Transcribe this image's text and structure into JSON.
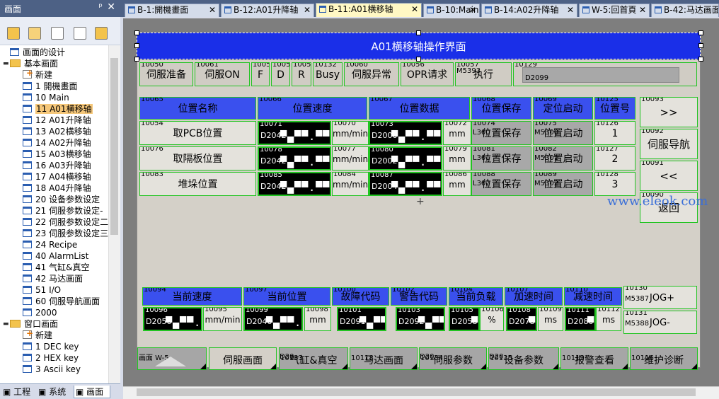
{
  "left_panel": {
    "title": "画面",
    "pin_glyph": "ᵖ",
    "close_glyph": "✕",
    "tree": {
      "design": "画面的设计",
      "basic_group": "基本画面",
      "basic_items": [
        "新建",
        "1 開機畫面",
        "10 Main",
        "11 A01横移轴",
        "12 A01升降轴",
        "13 A02横移轴",
        "14 A02升降轴",
        "15 A03横移轴",
        "16 A03升降轴",
        "17 A04横移轴",
        "18 A04升降轴",
        "20 设备参数设定",
        "21 伺服参数设定-",
        "22 伺服参数设定二",
        "23 伺服参数设定三",
        "24 Recipe",
        "40 AlarmList",
        "41 气缸&真空",
        "42 马达画面",
        "51 I/O",
        "60 伺服导航画面",
        "2000"
      ],
      "window_group": "窗口画面",
      "window_items": [
        "新建",
        "1 DEC key",
        "2 HEX key",
        "3 Ascii key"
      ]
    },
    "bottom_tabs": [
      "工程",
      "系统",
      "画面"
    ]
  },
  "doc_tabs": [
    {
      "label": "B-1:開機畫面"
    },
    {
      "label": "B-12:A01升降轴"
    },
    {
      "label": "B-11:A01横移轴"
    },
    {
      "label": "B-10:Main"
    },
    {
      "label": "B-14:A02升降轴"
    },
    {
      "label": "W-5:回首頁"
    },
    {
      "label": "B-42:马达画面"
    }
  ],
  "hmi": {
    "title": "A01横移轴操作界面",
    "status_row": [
      {
        "id": "10050",
        "label": "伺服准备"
      },
      {
        "id": "10061",
        "label": "伺服ON"
      },
      {
        "id": "10051",
        "label": "F"
      },
      {
        "id": "10052",
        "label": "D"
      },
      {
        "id": "10053",
        "label": "R"
      },
      {
        "id": "10132",
        "label": "Busy"
      },
      {
        "id": "10060",
        "label": "伺服异常"
      },
      {
        "id": "10056",
        "label": "OPR请求"
      },
      {
        "id": "10057",
        "label": "执行",
        "sub": "M5393"
      }
    ],
    "status_value": {
      "id": "10129",
      "reg": "D2099"
    },
    "table_headers": [
      {
        "id": "10065",
        "label": "位置名称"
      },
      {
        "id": "10066",
        "label": "位置速度"
      },
      {
        "id": "10067",
        "label": "位置数据"
      },
      {
        "id": "10068",
        "label": "位置保存"
      },
      {
        "id": "10069",
        "label": "定位启动"
      },
      {
        "id": "10125",
        "label": "位置号"
      }
    ],
    "rows": [
      {
        "name_id": "10054",
        "name": "取PCB位置",
        "spd_id": "10071",
        "spd_reg": "D2042",
        "spd_unit_id": "10070",
        "spd_unit": "mm/min",
        "pos_id": "10073",
        "pos_reg": "D2000",
        "pos_unit_id": "10072",
        "pos_unit": "mm",
        "save_id": "10074",
        "save_sub": "L300",
        "save": "位置保存",
        "start_id": "10075",
        "start_sub": "M5300",
        "start": "位置启动",
        "no_id": "10126",
        "no": "1"
      },
      {
        "name_id": "10076",
        "name": "取隔板位置",
        "spd_id": "10078",
        "spd_reg": "D2042",
        "spd_unit_id": "10077",
        "spd_unit": "mm/min",
        "pos_id": "10080",
        "pos_reg": "D2002",
        "pos_unit_id": "10079",
        "pos_unit": "mm",
        "save_id": "10081",
        "save_sub": "L301",
        "save": "位置保存",
        "start_id": "10082",
        "start_sub": "M5301",
        "start": "位置启动",
        "no_id": "10127",
        "no": "2"
      },
      {
        "name_id": "10083",
        "name": "堆垛位置",
        "spd_id": "10085",
        "spd_reg": "D2042",
        "spd_unit_id": "10084",
        "spd_unit": "mm/min",
        "pos_id": "10087",
        "pos_reg": "D2004",
        "pos_unit_id": "10086",
        "pos_unit": "mm",
        "save_id": "10088",
        "save_sub": "L302",
        "save": "位置保存",
        "start_id": "10089",
        "start_sub": "M5302",
        "start": "位置启动",
        "no_id": "10128",
        "no": "3"
      }
    ],
    "seg_mask": "▀▄▀▀.▀▀▀",
    "right_nav": [
      {
        "id": "10093",
        "label": ">>"
      },
      {
        "id": "10092",
        "label": "伺服导航"
      },
      {
        "id": "10091",
        "label": "<<"
      },
      {
        "id": "10090",
        "label": "返回"
      }
    ],
    "bottom_headers": [
      {
        "id": "10094",
        "label": "当前速度"
      },
      {
        "id": "10097",
        "label": "当前位置"
      },
      {
        "id": "10100",
        "label": "故障代码"
      },
      {
        "id": "10102",
        "label": "警告代码"
      },
      {
        "id": "10104",
        "label": "当前负载"
      },
      {
        "id": "10107",
        "label": "加速时间"
      },
      {
        "id": "10110",
        "label": "减速时间"
      }
    ],
    "bottom_values": [
      {
        "id": "10096",
        "reg": "D2056",
        "unit_id": "10095",
        "unit": "mm/min"
      },
      {
        "id": "10099",
        "reg": "D2040",
        "unit_id": "10098",
        "unit": "mm"
      },
      {
        "id": "10101",
        "reg": "D2091",
        "unit_id": "",
        "unit": ""
      },
      {
        "id": "10103",
        "reg": "D2092",
        "unit_id": "",
        "unit": ""
      },
      {
        "id": "10105",
        "reg": "D2058",
        "unit_id": "10106",
        "unit": "%"
      },
      {
        "id": "10108",
        "reg": "D2078",
        "unit_id": "10109",
        "unit": "ms"
      },
      {
        "id": "10111",
        "reg": "D2080",
        "unit_id": "10112",
        "unit": "ms"
      }
    ],
    "jog": [
      {
        "id": "10130",
        "sub": "M5387",
        "label": "JOG+"
      },
      {
        "id": "10131",
        "sub": "M5388",
        "label": "JOG-"
      }
    ],
    "bottom_nav": [
      {
        "id": "画面 W-5",
        "label": ""
      },
      {
        "id": "",
        "label": "伺服画面"
      },
      {
        "id": "10133",
        "sub": "D20",
        "label": "气缸&真空"
      },
      {
        "id": "10118",
        "label": "马达画面"
      },
      {
        "id": "10134",
        "sub": "D20",
        "label": "伺服参数"
      },
      {
        "id": "10135",
        "sub": "D20",
        "label": "设备参数"
      },
      {
        "id": "10119",
        "label": "报警查看"
      },
      {
        "id": "10116",
        "label": "维护诊断"
      }
    ],
    "watermark": "www.eleok.com"
  }
}
